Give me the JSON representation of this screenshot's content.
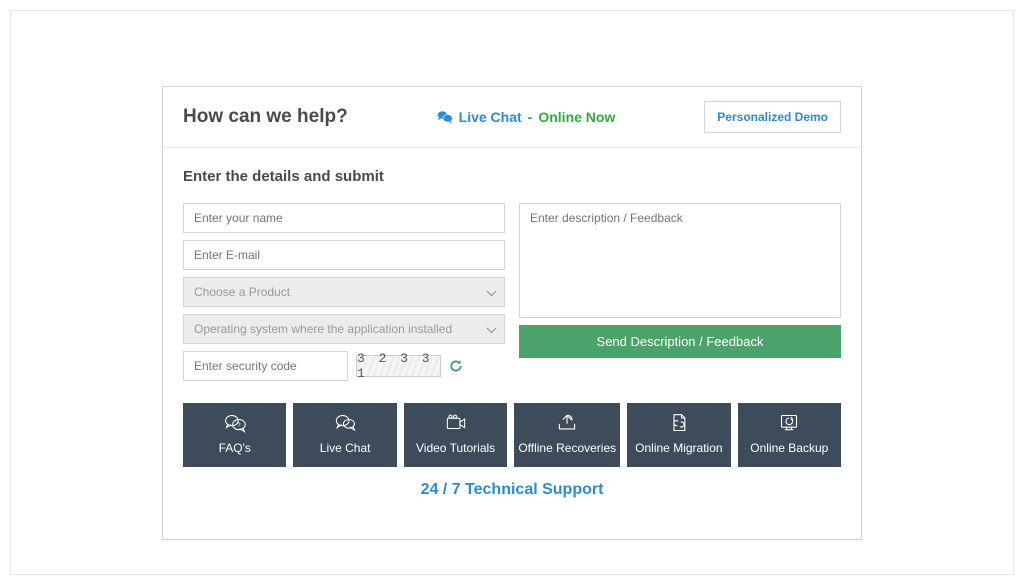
{
  "header": {
    "title": "How can we help?",
    "live_chat_label": "Live Chat",
    "live_chat_sep": " - ",
    "live_chat_status": "Online Now",
    "demo_button": "Personalized Demo"
  },
  "form": {
    "subtitle": "Enter the details and submit",
    "name_placeholder": "Enter your name",
    "email_placeholder": "Enter E-mail",
    "product_placeholder": "Choose a Product",
    "os_placeholder": "Operating system where the application installed",
    "code_placeholder": "Enter security code",
    "captcha_value": "3 2 3 3 1",
    "description_placeholder": "Enter description / Feedback",
    "submit_label": "Send Description / Feedback"
  },
  "tiles": [
    {
      "label": "FAQ's"
    },
    {
      "label": "Live Chat"
    },
    {
      "label": "Video Tutorials"
    },
    {
      "label": "Offline Recoveries"
    },
    {
      "label": "Online Migration"
    },
    {
      "label": "Online Backup"
    }
  ],
  "footer": {
    "text": "24 / 7 Technical Support"
  }
}
